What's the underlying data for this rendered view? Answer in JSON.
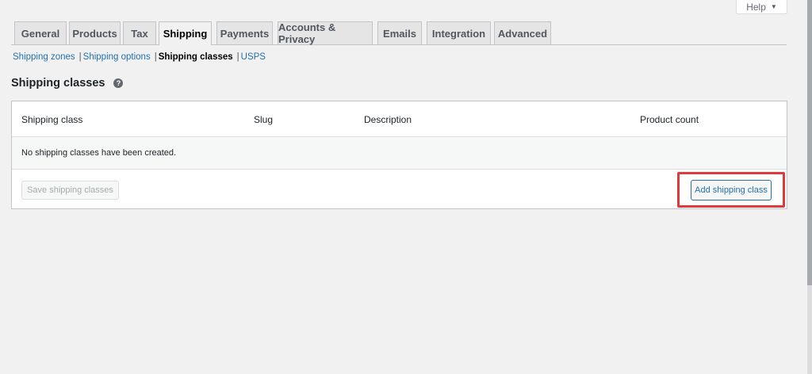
{
  "help": {
    "label": "Help",
    "caret": "▼"
  },
  "tabs": [
    {
      "label": "General"
    },
    {
      "label": "Products"
    },
    {
      "label": "Tax"
    },
    {
      "label": "Shipping"
    },
    {
      "label": "Payments"
    },
    {
      "label": "Accounts & Privacy"
    },
    {
      "label": "Emails"
    },
    {
      "label": "Integration"
    },
    {
      "label": "Advanced"
    }
  ],
  "active_tab": "Shipping",
  "subnav": {
    "items": [
      "Shipping zones",
      "Shipping options",
      "Shipping classes",
      "USPS"
    ],
    "current": "Shipping classes",
    "separator": "|"
  },
  "page": {
    "title": "Shipping classes",
    "help_icon": "?"
  },
  "table": {
    "columns": [
      "Shipping class",
      "Slug",
      "Description",
      "Product count"
    ],
    "empty_message": "No shipping classes have been created.",
    "save_label": "Save shipping classes",
    "add_label": "Add shipping class"
  },
  "colors": {
    "background": "#f1f1f1",
    "link": "#2271b1",
    "highlight": "#e0393e",
    "tab_inactive": "#e5e5e5",
    "border": "#c3c4c7"
  }
}
